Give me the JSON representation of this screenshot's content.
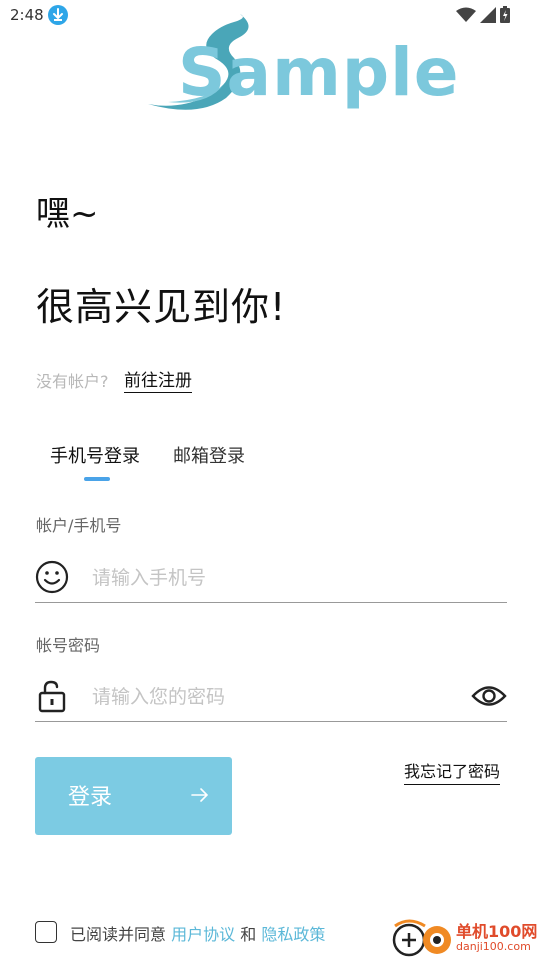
{
  "status_bar": {
    "time": "2:48"
  },
  "logo": {
    "text": "Sample"
  },
  "greeting": "嘿~",
  "headline": "很高兴见到你!",
  "register": {
    "prompt": "没有帐户?",
    "link": "前往注册"
  },
  "tabs": [
    {
      "label": "手机号登录",
      "active": true
    },
    {
      "label": "邮箱登录",
      "active": false
    }
  ],
  "account_field": {
    "label": "帐户/手机号",
    "placeholder": "请输入手机号",
    "value": ""
  },
  "password_field": {
    "label": "帐号密码",
    "placeholder": "请输入您的密码",
    "value": ""
  },
  "login_button": {
    "label": "登录"
  },
  "forgot_password": "我忘记了密码",
  "agreement": {
    "checked": false,
    "prefix": "已阅读并同意",
    "user_agreement": "用户协议",
    "and": "和",
    "privacy_policy": "隐私政策"
  },
  "watermark": {
    "line1": "单机100网",
    "line2": "danji100.com"
  },
  "colors": {
    "accent": "#7ccbe3",
    "link": "#5cb8d8",
    "tab_indicator": "#4aa3e8"
  },
  "icons": [
    "download-icon",
    "wifi-icon",
    "signal-icon",
    "battery-icon",
    "smiley-icon",
    "lock-icon",
    "eye-icon",
    "arrow-right-icon"
  ]
}
